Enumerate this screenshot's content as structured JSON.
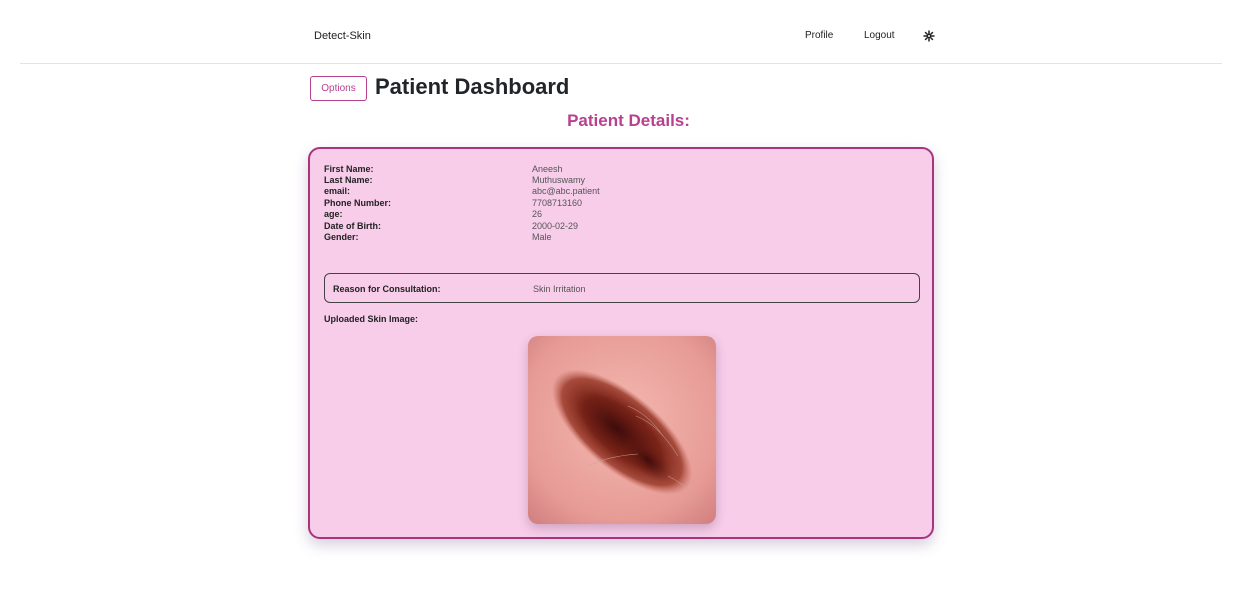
{
  "navbar": {
    "brand": "Detect-Skin",
    "links": {
      "profile": "Profile",
      "logout": "Logout"
    },
    "theme_icon": "gear-icon"
  },
  "header": {
    "options_label": "Options",
    "title": "Patient Dashboard"
  },
  "section_title": "Patient Details:",
  "patient": {
    "fields": [
      {
        "label": "First Name:",
        "value": "Aneesh"
      },
      {
        "label": "Last Name:",
        "value": "Muthuswamy"
      },
      {
        "label": "email:",
        "value": "abc@abc.patient"
      },
      {
        "label": "Phone Number:",
        "value": "7708713160"
      },
      {
        "label": "age:",
        "value": "26"
      },
      {
        "label": "Date of Birth:",
        "value": "2000-02-29"
      },
      {
        "label": "Gender:",
        "value": "Male"
      }
    ],
    "reason": {
      "label": "Reason for Consultation:",
      "value": "Skin Irritation"
    },
    "upload_label": "Uploaded Skin Image:"
  },
  "colors": {
    "accent": "#b7408f",
    "card_bg": "#f7cdea",
    "card_border": "#a8347f"
  }
}
